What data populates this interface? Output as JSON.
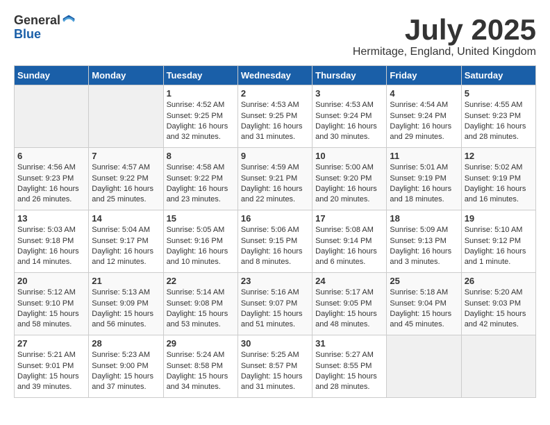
{
  "logo": {
    "general": "General",
    "blue": "Blue"
  },
  "title": "July 2025",
  "location": "Hermitage, England, United Kingdom",
  "days_of_week": [
    "Sunday",
    "Monday",
    "Tuesday",
    "Wednesday",
    "Thursday",
    "Friday",
    "Saturday"
  ],
  "weeks": [
    [
      {
        "day": "",
        "sunrise": "",
        "sunset": "",
        "daylight": "",
        "empty": true
      },
      {
        "day": "",
        "sunrise": "",
        "sunset": "",
        "daylight": "",
        "empty": true
      },
      {
        "day": "1",
        "sunrise": "Sunrise: 4:52 AM",
        "sunset": "Sunset: 9:25 PM",
        "daylight": "Daylight: 16 hours and 32 minutes."
      },
      {
        "day": "2",
        "sunrise": "Sunrise: 4:53 AM",
        "sunset": "Sunset: 9:25 PM",
        "daylight": "Daylight: 16 hours and 31 minutes."
      },
      {
        "day": "3",
        "sunrise": "Sunrise: 4:53 AM",
        "sunset": "Sunset: 9:24 PM",
        "daylight": "Daylight: 16 hours and 30 minutes."
      },
      {
        "day": "4",
        "sunrise": "Sunrise: 4:54 AM",
        "sunset": "Sunset: 9:24 PM",
        "daylight": "Daylight: 16 hours and 29 minutes."
      },
      {
        "day": "5",
        "sunrise": "Sunrise: 4:55 AM",
        "sunset": "Sunset: 9:23 PM",
        "daylight": "Daylight: 16 hours and 28 minutes."
      }
    ],
    [
      {
        "day": "6",
        "sunrise": "Sunrise: 4:56 AM",
        "sunset": "Sunset: 9:23 PM",
        "daylight": "Daylight: 16 hours and 26 minutes."
      },
      {
        "day": "7",
        "sunrise": "Sunrise: 4:57 AM",
        "sunset": "Sunset: 9:22 PM",
        "daylight": "Daylight: 16 hours and 25 minutes."
      },
      {
        "day": "8",
        "sunrise": "Sunrise: 4:58 AM",
        "sunset": "Sunset: 9:22 PM",
        "daylight": "Daylight: 16 hours and 23 minutes."
      },
      {
        "day": "9",
        "sunrise": "Sunrise: 4:59 AM",
        "sunset": "Sunset: 9:21 PM",
        "daylight": "Daylight: 16 hours and 22 minutes."
      },
      {
        "day": "10",
        "sunrise": "Sunrise: 5:00 AM",
        "sunset": "Sunset: 9:20 PM",
        "daylight": "Daylight: 16 hours and 20 minutes."
      },
      {
        "day": "11",
        "sunrise": "Sunrise: 5:01 AM",
        "sunset": "Sunset: 9:19 PM",
        "daylight": "Daylight: 16 hours and 18 minutes."
      },
      {
        "day": "12",
        "sunrise": "Sunrise: 5:02 AM",
        "sunset": "Sunset: 9:19 PM",
        "daylight": "Daylight: 16 hours and 16 minutes."
      }
    ],
    [
      {
        "day": "13",
        "sunrise": "Sunrise: 5:03 AM",
        "sunset": "Sunset: 9:18 PM",
        "daylight": "Daylight: 16 hours and 14 minutes."
      },
      {
        "day": "14",
        "sunrise": "Sunrise: 5:04 AM",
        "sunset": "Sunset: 9:17 PM",
        "daylight": "Daylight: 16 hours and 12 minutes."
      },
      {
        "day": "15",
        "sunrise": "Sunrise: 5:05 AM",
        "sunset": "Sunset: 9:16 PM",
        "daylight": "Daylight: 16 hours and 10 minutes."
      },
      {
        "day": "16",
        "sunrise": "Sunrise: 5:06 AM",
        "sunset": "Sunset: 9:15 PM",
        "daylight": "Daylight: 16 hours and 8 minutes."
      },
      {
        "day": "17",
        "sunrise": "Sunrise: 5:08 AM",
        "sunset": "Sunset: 9:14 PM",
        "daylight": "Daylight: 16 hours and 6 minutes."
      },
      {
        "day": "18",
        "sunrise": "Sunrise: 5:09 AM",
        "sunset": "Sunset: 9:13 PM",
        "daylight": "Daylight: 16 hours and 3 minutes."
      },
      {
        "day": "19",
        "sunrise": "Sunrise: 5:10 AM",
        "sunset": "Sunset: 9:12 PM",
        "daylight": "Daylight: 16 hours and 1 minute."
      }
    ],
    [
      {
        "day": "20",
        "sunrise": "Sunrise: 5:12 AM",
        "sunset": "Sunset: 9:10 PM",
        "daylight": "Daylight: 15 hours and 58 minutes."
      },
      {
        "day": "21",
        "sunrise": "Sunrise: 5:13 AM",
        "sunset": "Sunset: 9:09 PM",
        "daylight": "Daylight: 15 hours and 56 minutes."
      },
      {
        "day": "22",
        "sunrise": "Sunrise: 5:14 AM",
        "sunset": "Sunset: 9:08 PM",
        "daylight": "Daylight: 15 hours and 53 minutes."
      },
      {
        "day": "23",
        "sunrise": "Sunrise: 5:16 AM",
        "sunset": "Sunset: 9:07 PM",
        "daylight": "Daylight: 15 hours and 51 minutes."
      },
      {
        "day": "24",
        "sunrise": "Sunrise: 5:17 AM",
        "sunset": "Sunset: 9:05 PM",
        "daylight": "Daylight: 15 hours and 48 minutes."
      },
      {
        "day": "25",
        "sunrise": "Sunrise: 5:18 AM",
        "sunset": "Sunset: 9:04 PM",
        "daylight": "Daylight: 15 hours and 45 minutes."
      },
      {
        "day": "26",
        "sunrise": "Sunrise: 5:20 AM",
        "sunset": "Sunset: 9:03 PM",
        "daylight": "Daylight: 15 hours and 42 minutes."
      }
    ],
    [
      {
        "day": "27",
        "sunrise": "Sunrise: 5:21 AM",
        "sunset": "Sunset: 9:01 PM",
        "daylight": "Daylight: 15 hours and 39 minutes."
      },
      {
        "day": "28",
        "sunrise": "Sunrise: 5:23 AM",
        "sunset": "Sunset: 9:00 PM",
        "daylight": "Daylight: 15 hours and 37 minutes."
      },
      {
        "day": "29",
        "sunrise": "Sunrise: 5:24 AM",
        "sunset": "Sunset: 8:58 PM",
        "daylight": "Daylight: 15 hours and 34 minutes."
      },
      {
        "day": "30",
        "sunrise": "Sunrise: 5:25 AM",
        "sunset": "Sunset: 8:57 PM",
        "daylight": "Daylight: 15 hours and 31 minutes."
      },
      {
        "day": "31",
        "sunrise": "Sunrise: 5:27 AM",
        "sunset": "Sunset: 8:55 PM",
        "daylight": "Daylight: 15 hours and 28 minutes."
      },
      {
        "day": "",
        "sunrise": "",
        "sunset": "",
        "daylight": "",
        "empty": true
      },
      {
        "day": "",
        "sunrise": "",
        "sunset": "",
        "daylight": "",
        "empty": true
      }
    ]
  ]
}
